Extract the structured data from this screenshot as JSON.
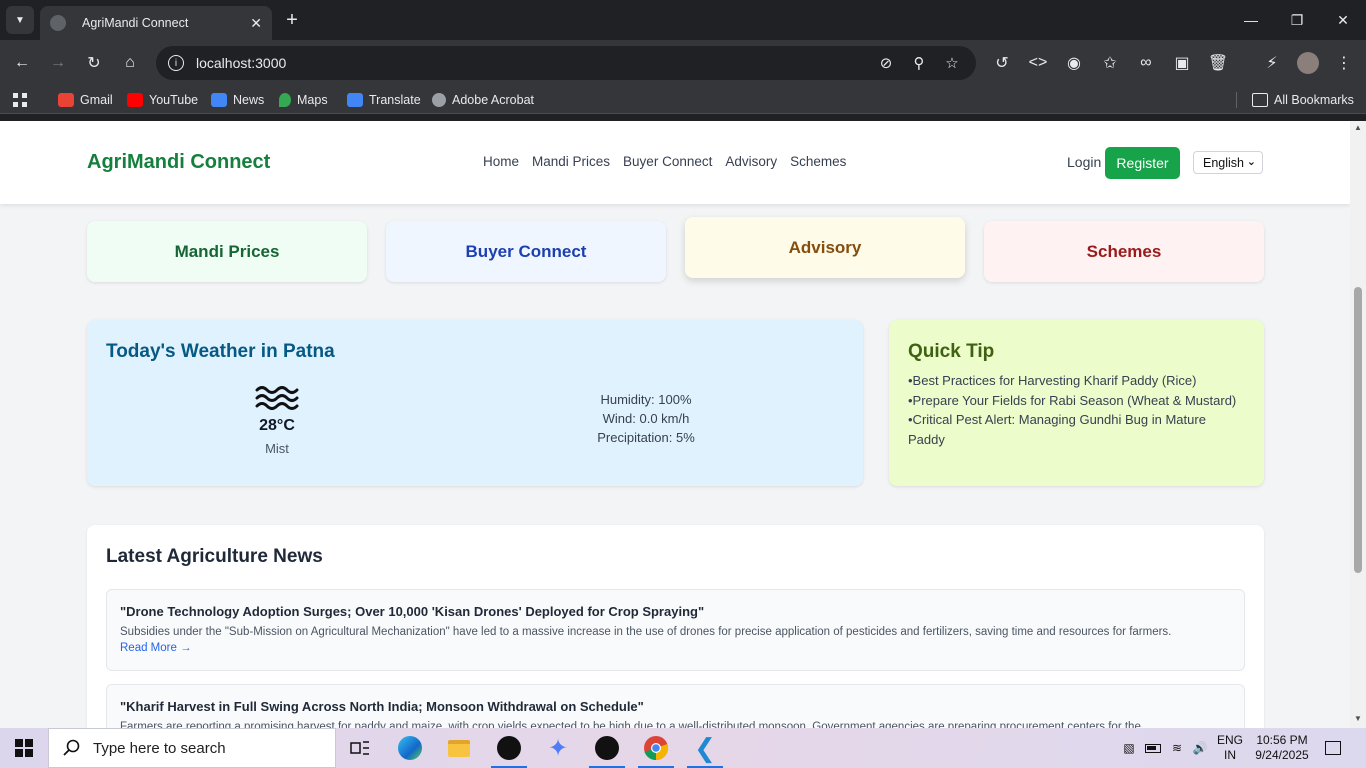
{
  "browser": {
    "tab_title": "AgriMandi Connect",
    "url": "localhost:3000",
    "bookmarks": [
      "Gmail",
      "YouTube",
      "News",
      "Maps",
      "Translate",
      "Adobe Acrobat"
    ],
    "all_bookmarks": "All Bookmarks"
  },
  "site": {
    "brand": "AgriMandi Connect",
    "nav": [
      "Home",
      "Mandi Prices",
      "Buyer Connect",
      "Advisory",
      "Schemes"
    ],
    "login": "Login",
    "register": "Register",
    "language": "English"
  },
  "quick_cards": [
    {
      "label": "Mandi Prices",
      "bg": "#f0fdf4",
      "color": "#166534"
    },
    {
      "label": "Buyer Connect",
      "bg": "#eff6ff",
      "color": "#1e40af"
    },
    {
      "label": "Advisory",
      "bg": "#fefce8",
      "color": "#854d0e"
    },
    {
      "label": "Schemes",
      "bg": "#fef2f2",
      "color": "#991b1b"
    }
  ],
  "weather": {
    "title": "Today's Weather in Patna",
    "icon": "mist-icon",
    "temp": "28°C",
    "condition": "Mist",
    "humidity": "Humidity: 100%",
    "wind": "Wind: 0.0 km/h",
    "precipitation": "Precipitation: 5%"
  },
  "tip": {
    "title": "Quick Tip",
    "items": [
      "•Best Practices for Harvesting Kharif Paddy (Rice)",
      "•Prepare Your Fields for Rabi Season (Wheat & Mustard)",
      "•Critical Pest Alert: Managing Gundhi Bug in Mature Paddy"
    ]
  },
  "news": {
    "title": "Latest Agriculture News",
    "items": [
      {
        "headline": "\"Drone Technology Adoption Surges; Over 10,000 'Kisan Drones' Deployed for Crop Spraying\"",
        "summary": "Subsidies under the \"Sub-Mission on Agricultural Mechanization\" have led to a massive increase in the use of drones for precise application of pesticides and fertilizers, saving time and resources for farmers.",
        "read_more": "Read More →"
      },
      {
        "headline": "\"Kharif Harvest in Full Swing Across North India; Monsoon Withdrawal on Schedule\"",
        "summary": "Farmers are reporting a promising harvest for paddy and maize, with crop yields expected to be high due to a well-distributed monsoon. Government agencies are preparing procurement centers for the",
        "read_more": ""
      }
    ]
  },
  "taskbar": {
    "search_placeholder": "Type here to search",
    "lang_line1": "ENG",
    "lang_line2": "IN",
    "time": "10:56 PM",
    "date": "9/24/2025"
  }
}
